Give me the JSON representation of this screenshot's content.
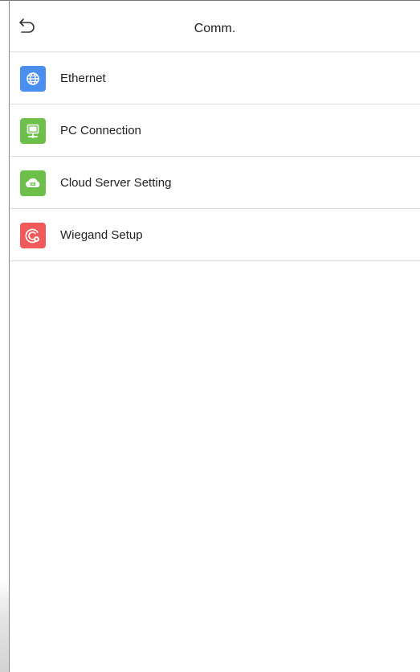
{
  "header": {
    "title": "Comm.",
    "back_icon": "back-arrow-icon"
  },
  "menu": {
    "items": [
      {
        "label": "Ethernet",
        "icon": "globe-icon",
        "color": "#4a8ff0"
      },
      {
        "label": "PC Connection",
        "icon": "monitor-icon",
        "color": "#6cc04a"
      },
      {
        "label": "Cloud Server Setting",
        "icon": "cloud-icon",
        "color": "#6cc04a"
      },
      {
        "label": "Wiegand Setup",
        "icon": "wiegand-icon",
        "color": "#f05a5a"
      }
    ]
  }
}
